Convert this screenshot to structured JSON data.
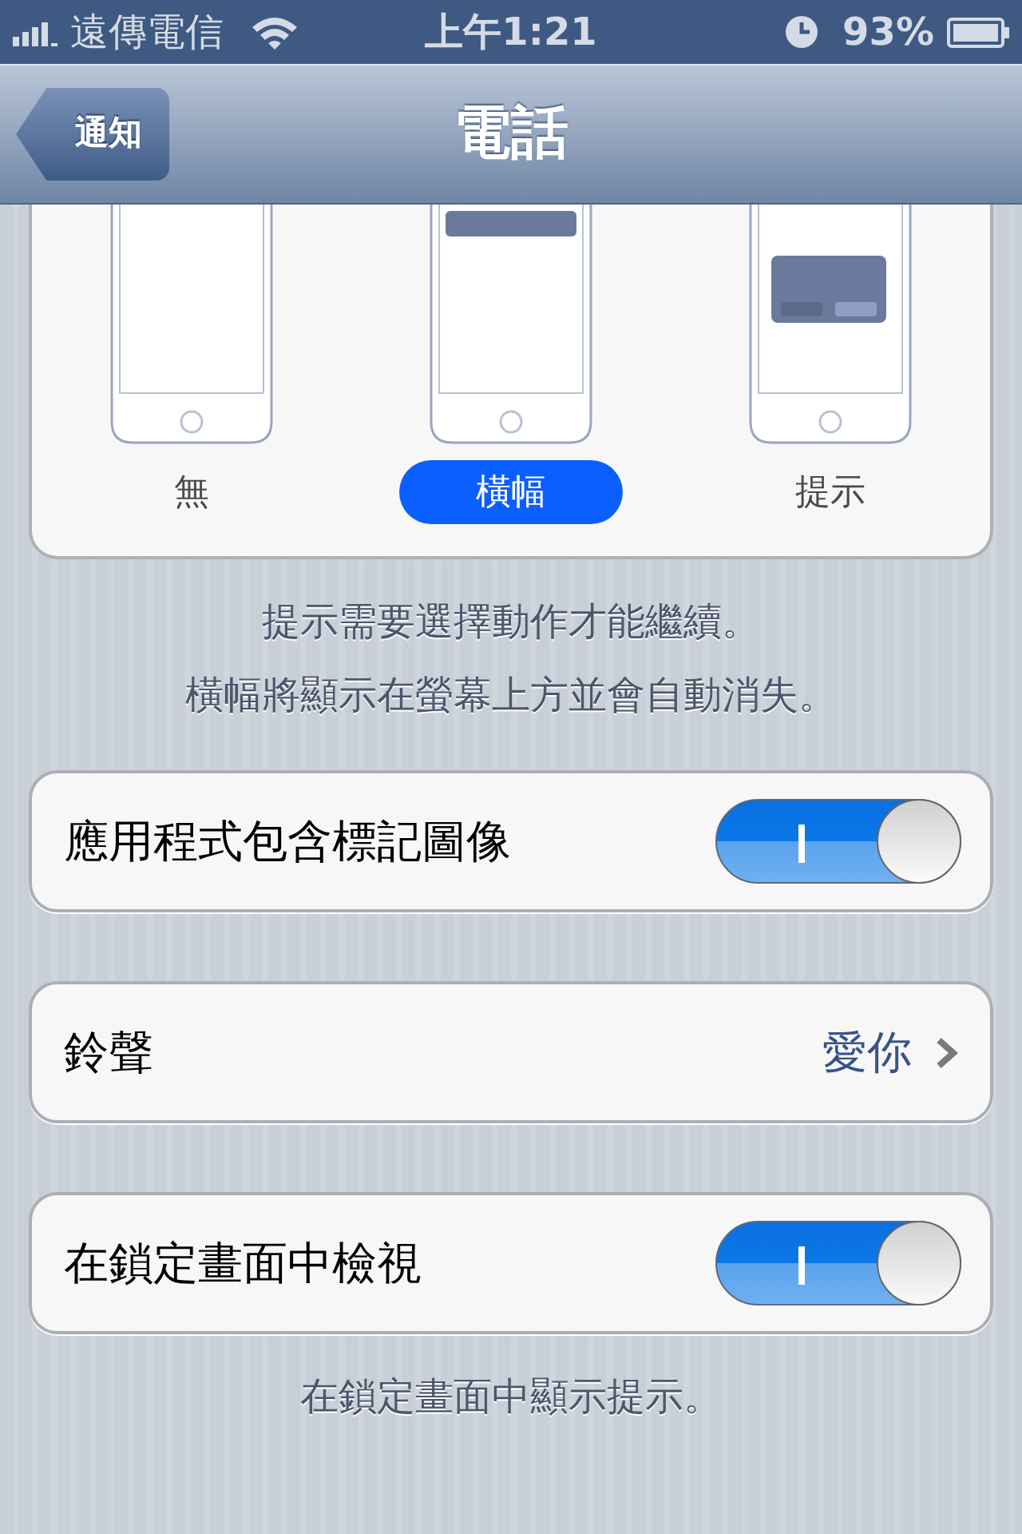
{
  "status_bar": {
    "carrier": "遠傳電信",
    "time": "上午1:21",
    "battery": "93%"
  },
  "nav": {
    "back": "通知",
    "title": "電話"
  },
  "alert_styles": [
    {
      "label": "無",
      "kind": "none",
      "selected": false
    },
    {
      "label": "橫幅",
      "kind": "banner",
      "selected": true
    },
    {
      "label": "提示",
      "kind": "alert",
      "selected": false
    }
  ],
  "alert_footer": [
    "提示需要選擇動作才能繼續。",
    "橫幅將顯示在螢幕上方並會自動消失。"
  ],
  "groups": [
    {
      "rows": [
        {
          "kind": "switch",
          "label": "應用程式包含標記圖像",
          "on": true
        }
      ]
    },
    {
      "rows": [
        {
          "kind": "link",
          "label": "鈴聲",
          "value": "愛你"
        }
      ]
    },
    {
      "rows": [
        {
          "kind": "switch",
          "label": "在鎖定畫面中檢視",
          "on": true
        }
      ],
      "footer": "在鎖定畫面中顯示提示。"
    }
  ]
}
